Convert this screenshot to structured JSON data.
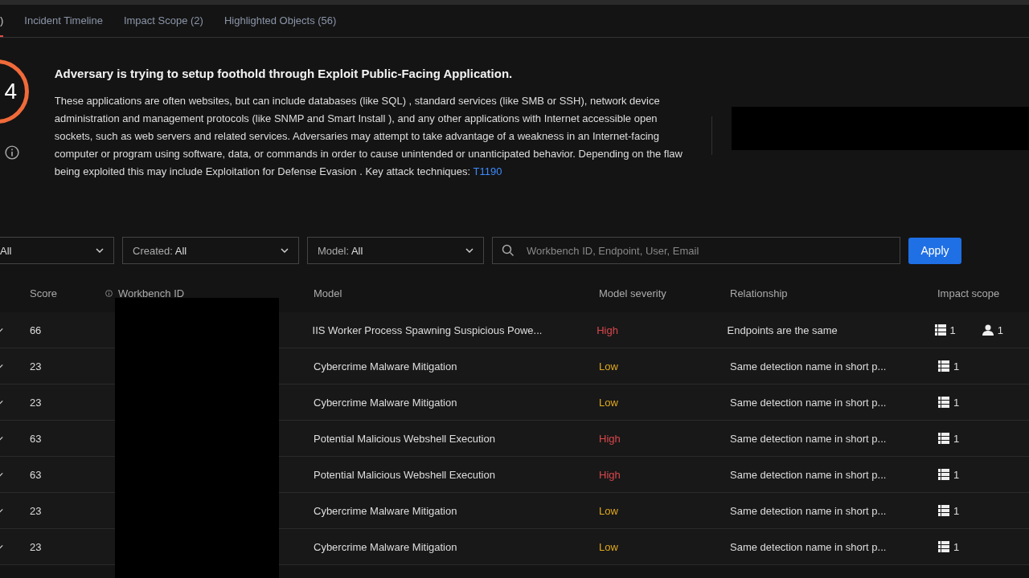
{
  "tabs": [
    {
      "label": ")",
      "selected": true
    },
    {
      "label": "Incident Timeline",
      "selected": false
    },
    {
      "label": "Impact Scope (2)",
      "selected": false
    },
    {
      "label": "Highlighted Objects (56)",
      "selected": false
    }
  ],
  "summary": {
    "score": "4",
    "title": "Adversary is trying to setup foothold through Exploit Public-Facing Application.",
    "description": "These applications are often websites, but can include databases (like SQL) , standard services (like SMB or SSH), network device administration and management protocols (like SNMP and Smart Install ), and any other applications with Internet accessible open sockets, such as web servers and related services. Adversaries may attempt to take advantage of a weakness in an Internet-facing computer or program using software, data, or commands in order to cause unintended or unanticipated behavior. Depending on the flaw being exploited this may include Exploitation for Defense Evasion . Key attack techniques: ",
    "technique_link": "T1190"
  },
  "filters": [
    {
      "value": "All"
    },
    {
      "label": "Created: ",
      "value": "All"
    },
    {
      "label": "Model: ",
      "value": "All"
    }
  ],
  "search": {
    "placeholder": "Workbench ID, Endpoint, User, Email"
  },
  "apply_button": "Apply",
  "table": {
    "columns": [
      "Score",
      "Workbench ID",
      "Model",
      "Model severity",
      "Relationship",
      "Impact scope"
    ],
    "rows": [
      {
        "score": "66",
        "model": "IIS Worker Process Spawning Suspicious Powe...",
        "severity": {
          "label": "High",
          "color": "#d9474c"
        },
        "relationship": "Endpoints are the same",
        "impact": [
          {
            "kind": "endpoint",
            "count": "1"
          },
          {
            "kind": "user",
            "count": "1"
          }
        ]
      },
      {
        "score": "23",
        "model": "Cybercrime Malware Mitigation",
        "severity": {
          "label": "Low",
          "color": "#e0a81e"
        },
        "relationship": "Same detection name in short p...",
        "impact": [
          {
            "kind": "endpoint",
            "count": "1"
          }
        ]
      },
      {
        "score": "23",
        "model": "Cybercrime Malware Mitigation",
        "severity": {
          "label": "Low",
          "color": "#e0a81e"
        },
        "relationship": "Same detection name in short p...",
        "impact": [
          {
            "kind": "endpoint",
            "count": "1"
          }
        ]
      },
      {
        "score": "63",
        "model": "Potential Malicious Webshell Execution",
        "severity": {
          "label": "High",
          "color": "#d9474c"
        },
        "relationship": "Same detection name in short p...",
        "impact": [
          {
            "kind": "endpoint",
            "count": "1"
          }
        ]
      },
      {
        "score": "63",
        "model": "Potential Malicious Webshell Execution",
        "severity": {
          "label": "High",
          "color": "#d9474c"
        },
        "relationship": "Same detection name in short p...",
        "impact": [
          {
            "kind": "endpoint",
            "count": "1"
          }
        ]
      },
      {
        "score": "23",
        "model": "Cybercrime Malware Mitigation",
        "severity": {
          "label": "Low",
          "color": "#e0a81e"
        },
        "relationship": "Same detection name in short p...",
        "impact": [
          {
            "kind": "endpoint",
            "count": "1"
          }
        ]
      },
      {
        "score": "23",
        "model": "Cybercrime Malware Mitigation",
        "severity": {
          "label": "Low",
          "color": "#e0a81e"
        },
        "relationship": "Same detection name in short p...",
        "impact": [
          {
            "kind": "endpoint",
            "count": "1"
          }
        ]
      }
    ]
  }
}
